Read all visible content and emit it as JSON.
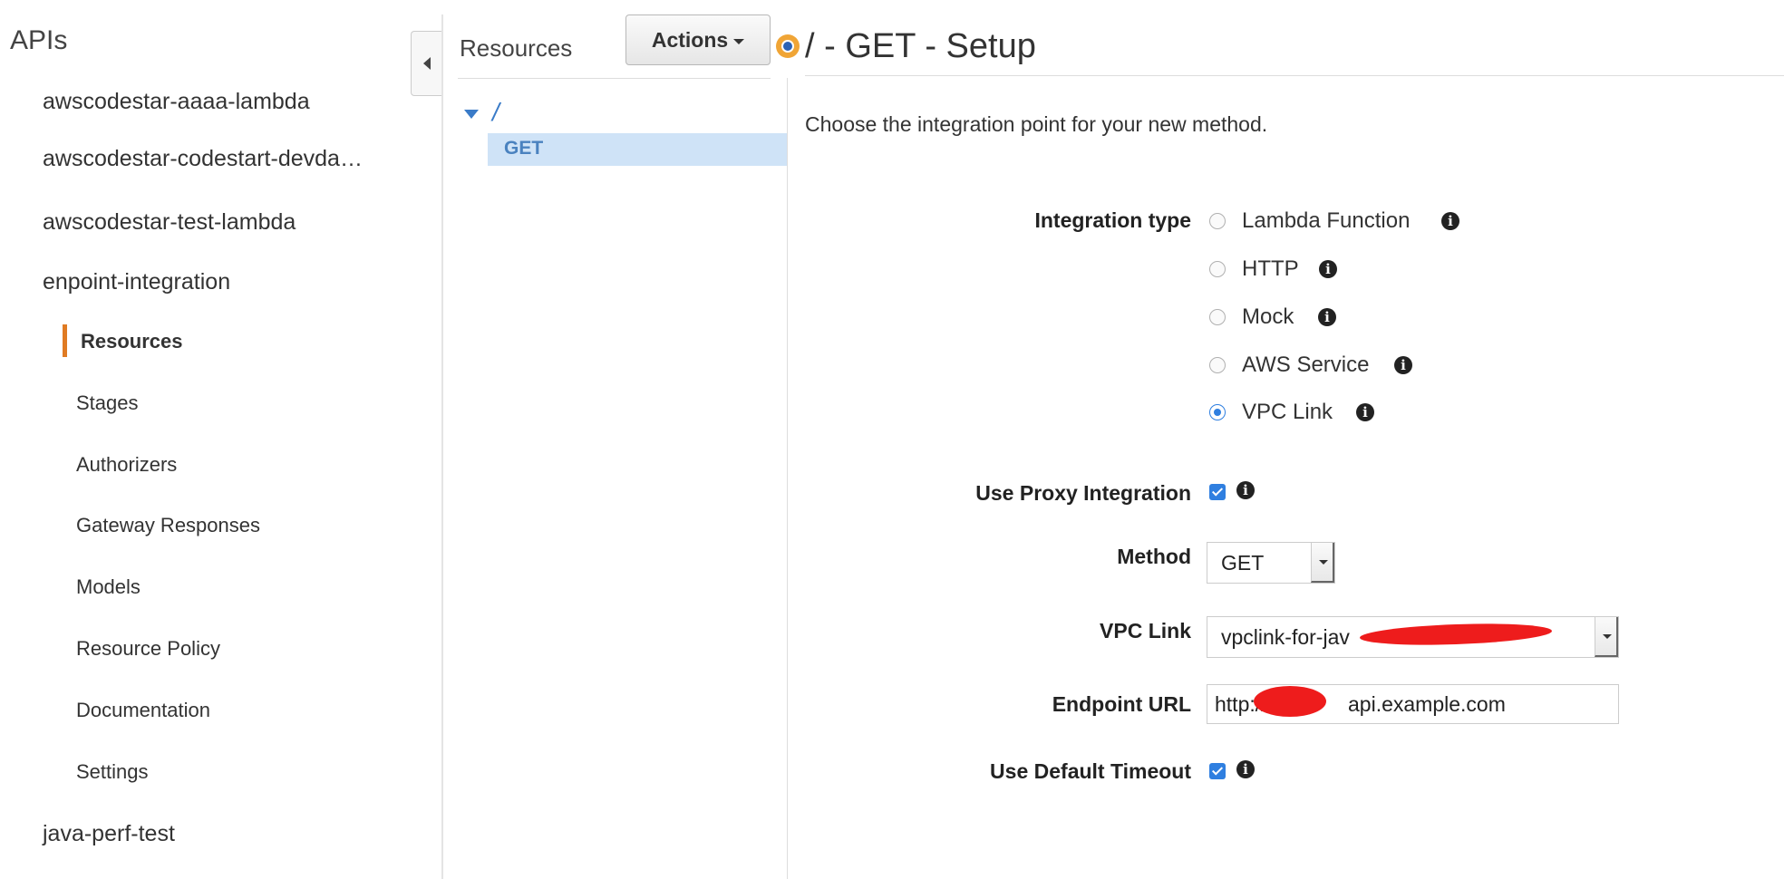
{
  "sidebar": {
    "title": "APIs",
    "apis": [
      "awscodestar-aaaa-lambda",
      "awscodestar-codestart-devda…",
      "awscodestar-test-lambda",
      "enpoint-integration"
    ],
    "sub_items": [
      "Resources",
      "Stages",
      "Authorizers",
      "Gateway Responses",
      "Models",
      "Resource Policy",
      "Documentation",
      "Settings"
    ],
    "active_sub_item": "Resources",
    "last_api": "java-perf-test"
  },
  "resources": {
    "title": "Resources",
    "actions_label": "Actions",
    "root_path": "/",
    "selected_method": "GET"
  },
  "setup": {
    "title": "/ - GET - Setup",
    "intro": "Choose the integration point for your new method.",
    "integration_type_label": "Integration type",
    "integration_types": [
      "Lambda Function",
      "HTTP",
      "Mock",
      "AWS Service",
      "VPC Link"
    ],
    "selected_integration_type": "VPC Link",
    "use_proxy_label": "Use Proxy Integration",
    "use_proxy_checked": true,
    "method_label": "Method",
    "method_value": "GET",
    "vpc_link_label": "VPC Link",
    "vpc_link_value": "vpclink-for-jav",
    "endpoint_label": "Endpoint URL",
    "endpoint_value": "http://              api.example.com",
    "default_timeout_label": "Use Default Timeout",
    "default_timeout_checked": true,
    "info_glyph": "i"
  },
  "colors": {
    "accent_orange": "#e07b23",
    "link_blue": "#3a7bc8",
    "selection_bg": "#cfe3f7",
    "control_blue": "#2f7fe0",
    "redaction_red": "#ee1c1c"
  }
}
